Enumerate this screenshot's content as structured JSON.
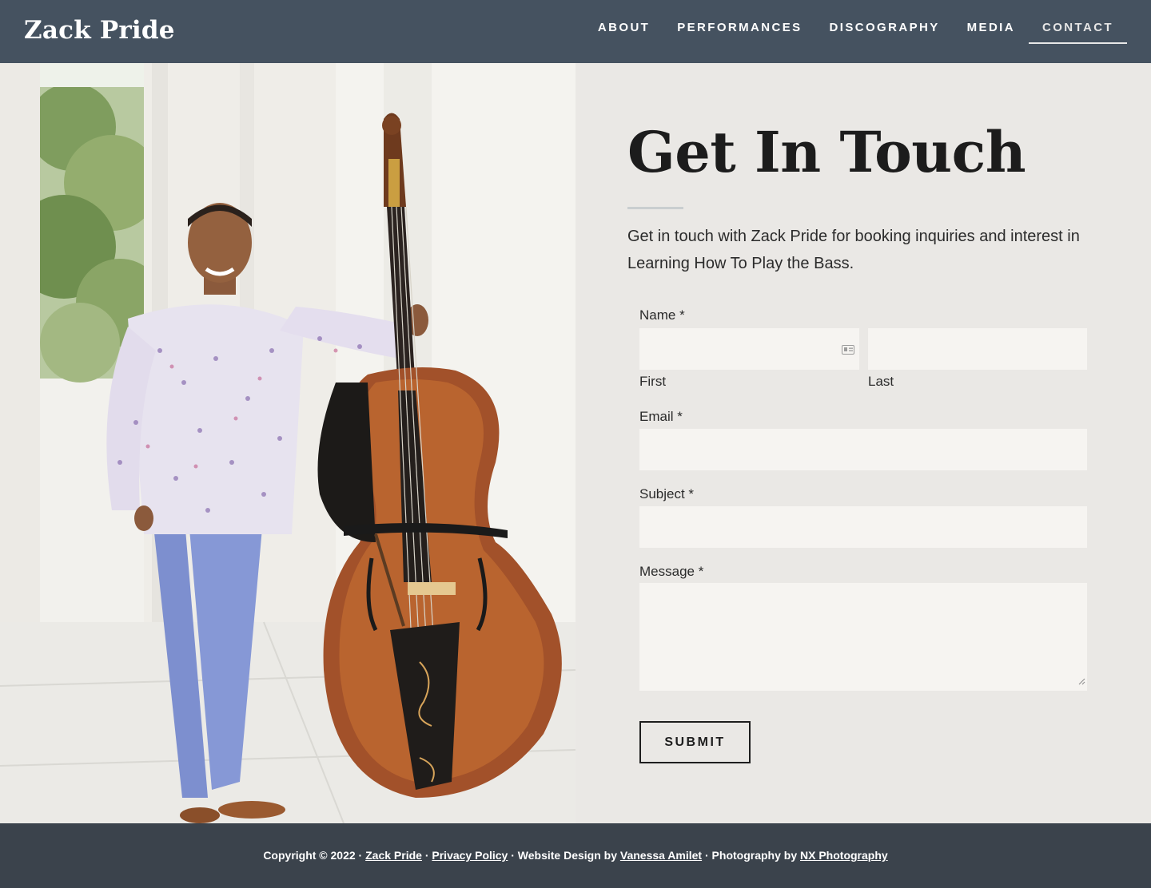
{
  "header": {
    "site_title": "Zack Pride",
    "nav": [
      {
        "label": "ABOUT"
      },
      {
        "label": "PERFORMANCES"
      },
      {
        "label": "DISCOGRAPHY"
      },
      {
        "label": "MEDIA"
      },
      {
        "label": "CONTACT",
        "active": true
      }
    ]
  },
  "photo": {
    "subject": "musician-with-double-bass-photo"
  },
  "contact": {
    "heading": "Get In Touch",
    "intro": "Get in touch with Zack Pride for booking inquiries and interest in Learning How To Play the Bass.",
    "form": {
      "name_label": "Name *",
      "first_sublabel": "First",
      "last_sublabel": "Last",
      "first_value": "",
      "last_value": "",
      "email_label": "Email *",
      "email_value": "",
      "subject_label": "Subject *",
      "subject_value": "",
      "message_label": "Message *",
      "message_value": "",
      "submit_label": "SUBMIT"
    }
  },
  "footer": {
    "prefix": "Copyright © 2022 · ",
    "site_link": "Zack Pride",
    "sep1": " · ",
    "privacy_link": "Privacy Policy",
    "design_text": " · Website Design by ",
    "designer_link": "Vanessa Amilet",
    "photo_text": " · Photography by ",
    "photographer_link": "NX Photography"
  },
  "colors": {
    "header_bg": "#455260",
    "content_bg": "#eae8e5",
    "field_bg": "#f6f4f1",
    "footer_bg": "#3b434c"
  }
}
